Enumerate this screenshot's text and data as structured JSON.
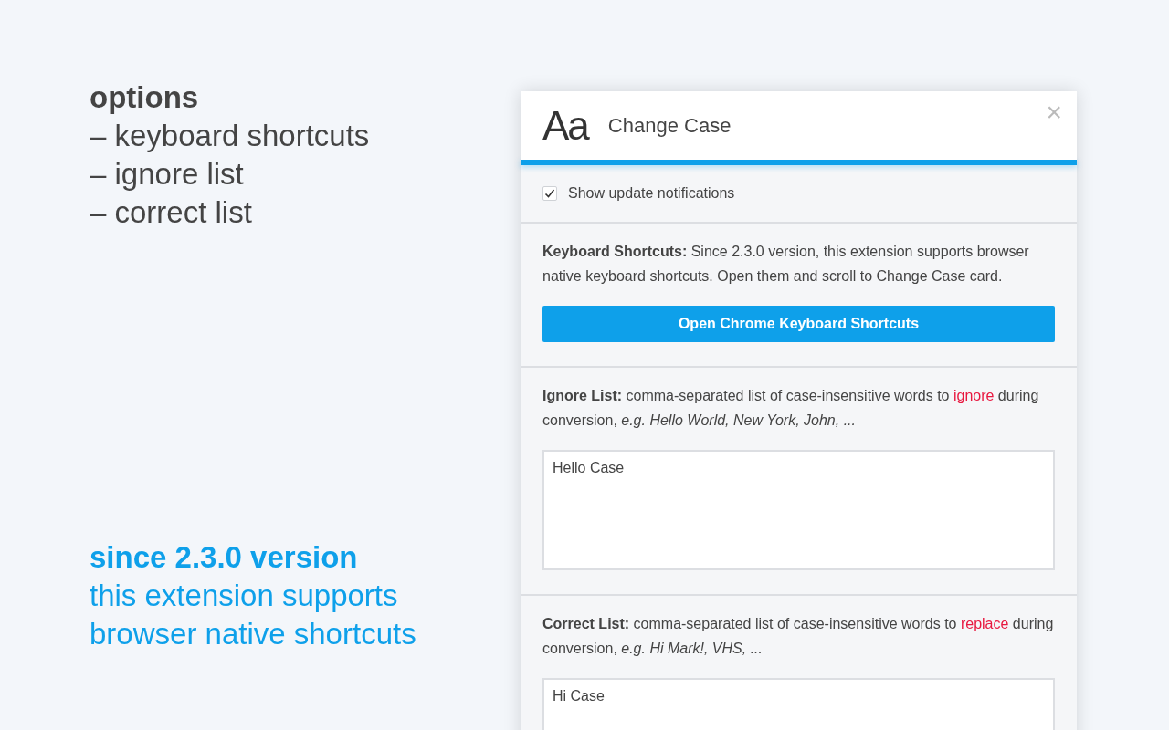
{
  "intro": {
    "heading": "options",
    "items": [
      "– keyboard shortcuts",
      "– ignore list",
      "– correct list"
    ]
  },
  "promo": {
    "heading": "since 2.3.0 version",
    "lines": [
      "this extension supports",
      "browser native shortcuts"
    ]
  },
  "panel": {
    "logo": "Aa",
    "title": "Change Case",
    "close": "×",
    "notification": {
      "label": "Show update notifications",
      "checked": true
    },
    "sections": [
      {
        "kind": "shortcuts",
        "description": "**Keyboard Shortcuts:** Since 2.3.0 version, this extension supports browser native keyboard shortcuts. Open them and scroll to Change Case card.",
        "button": "Open Chrome Keyboard Shortcuts"
      },
      {
        "kind": "list",
        "description": [
          {
            "text": "**Ignore List:** comma-separated list of case-insensitive words to ",
            "highlight": false
          },
          {
            "text": "ignore",
            "highlight": true
          },
          {
            "text": " during conversion, *e.g. Hello World, New York, John, ...*",
            "highlight": false
          }
        ],
        "value": "Hello Case"
      },
      {
        "kind": "list",
        "description": [
          {
            "text": "**Correct List:** comma-separated list of case-insensitive words to ",
            "highlight": false
          },
          {
            "text": "replace",
            "highlight": true
          },
          {
            "text": " during conversion, *e.g. Hi Mark!, VHS, ...*",
            "highlight": false
          }
        ],
        "value": "Hi Case"
      }
    ]
  }
}
